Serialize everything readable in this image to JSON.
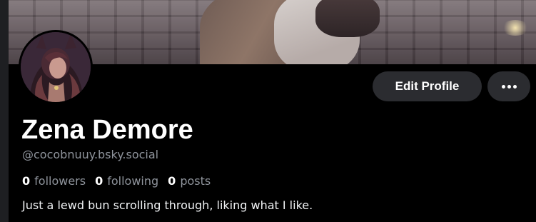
{
  "profile": {
    "display_name": "Zena Demore",
    "handle": "@cocobnuuy.bsky.social",
    "bio": "Just a lewd bun scrolling through, liking what I like."
  },
  "stats": [
    {
      "count": "0",
      "label": "followers"
    },
    {
      "count": "0",
      "label": "following"
    },
    {
      "count": "0",
      "label": "posts"
    }
  ],
  "actions": {
    "edit_label": "Edit Profile",
    "more_icon": "ellipsis-icon"
  },
  "colors": {
    "background": "#000000",
    "button_bg": "#2b2c30",
    "muted_text": "#8f949c"
  }
}
